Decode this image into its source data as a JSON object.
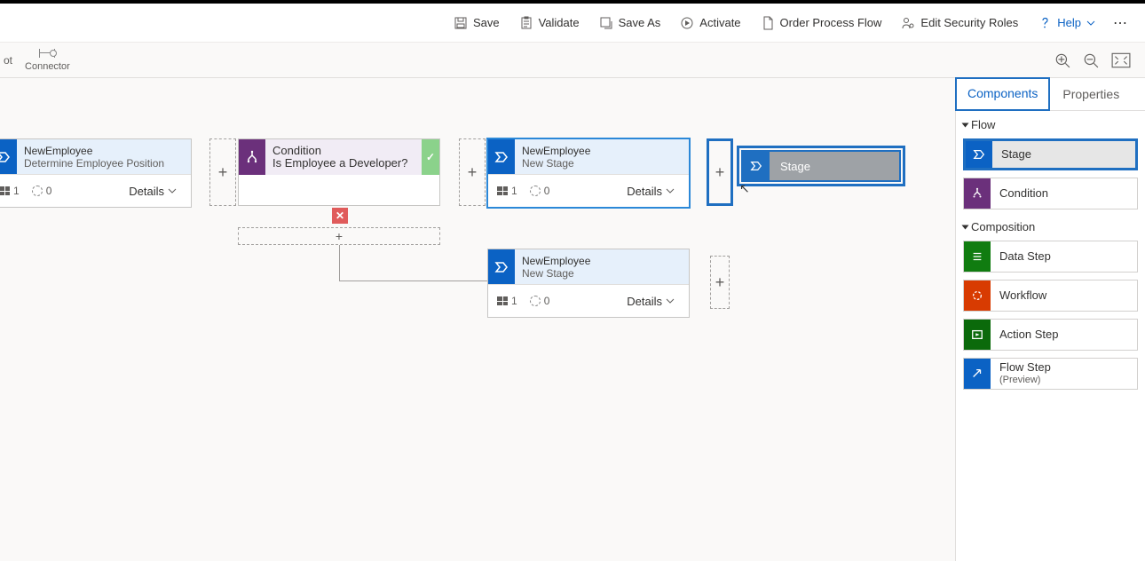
{
  "toolbar": {
    "save": "Save",
    "validate": "Validate",
    "save_as": "Save As",
    "activate": "Activate",
    "order": "Order Process Flow",
    "security": "Edit Security Roles",
    "help": "Help"
  },
  "subbar": {
    "connector": "Connector",
    "cut_label": "ot"
  },
  "canvas": {
    "stages": {
      "s1": {
        "entity": "NewEmployee",
        "name": "Determine Employee Position",
        "steps": "1",
        "loops": "0",
        "details": "Details"
      },
      "s2": {
        "entity": "NewEmployee",
        "name": "New Stage",
        "steps": "1",
        "loops": "0",
        "details": "Details"
      },
      "s3": {
        "entity": "NewEmployee",
        "name": "New Stage",
        "steps": "1",
        "loops": "0",
        "details": "Details"
      }
    },
    "condition": {
      "title": "Condition",
      "question": "Is Employee a Developer?"
    },
    "ghost_label": "Stage"
  },
  "side": {
    "tabs": {
      "components": "Components",
      "properties": "Properties"
    },
    "groups": {
      "flow": "Flow",
      "composition": "Composition"
    },
    "items": {
      "stage": "Stage",
      "condition": "Condition",
      "data_step": "Data Step",
      "workflow": "Workflow",
      "action_step": "Action Step",
      "flow_step": "Flow Step",
      "flow_step_sub": "(Preview)"
    }
  }
}
